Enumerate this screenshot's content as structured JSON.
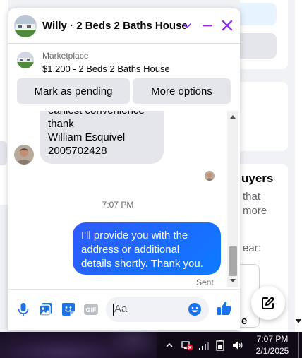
{
  "background": {
    "heading_fragment": "uyers",
    "text_line_1": "that",
    "text_line_2": "more",
    "text_line_3": "ear:",
    "text_line_4": "e"
  },
  "chat": {
    "title": "Willy · 2 Beds 2 Baths House",
    "accent_color": "#8b2ee8",
    "listing": {
      "source": "Marketplace",
      "detail": "$1,200 - 2 Beds 2 Baths House",
      "buttons": [
        "Mark as pending",
        "More options"
      ]
    },
    "messages": {
      "incoming_lines": [
        "earliest convenience",
        "thank",
        "William Esquivel",
        "2005702428"
      ],
      "timestamp": "7:07 PM",
      "outgoing_lines": [
        "I'll provide you with the",
        "address or additional",
        "details shortly. Thank you."
      ],
      "status": "Sent"
    },
    "composer": {
      "placeholder": "Aa",
      "icons": [
        "microphone-icon",
        "gallery-icon",
        "sticker-icon",
        "gif-icon",
        "emoji-icon",
        "like-icon"
      ]
    }
  },
  "taskbar": {
    "time": "7:07 PM",
    "date": "2/1/2025"
  }
}
